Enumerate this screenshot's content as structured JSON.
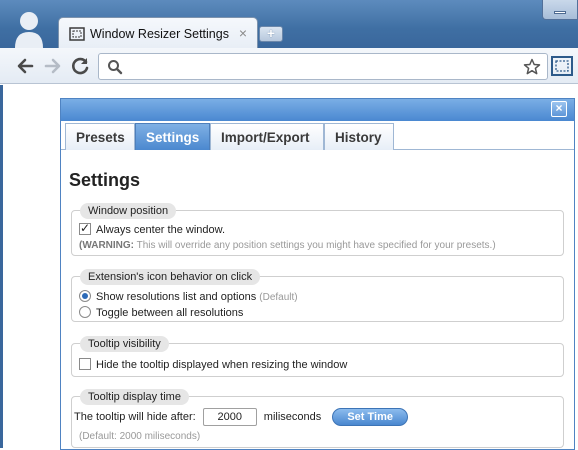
{
  "browser": {
    "tab_title": "Window Resizer Settings",
    "tab_close": "×",
    "new_tab": "+",
    "icons": [
      "profile-icon",
      "window-icon",
      "back-arrow-icon",
      "forward-arrow-icon",
      "reload-icon",
      "search-icon",
      "star-icon",
      "window-resizer-icon"
    ],
    "omnibox_value": ""
  },
  "popup": {
    "close": "×",
    "tabs": [
      {
        "label": "Presets",
        "active": false
      },
      {
        "label": "Settings",
        "active": true
      },
      {
        "label": "Import/Export",
        "active": false
      },
      {
        "label": "History",
        "active": false
      }
    ],
    "title": "Settings",
    "window_position": {
      "legend": "Window position",
      "center_label": "Always center the window.",
      "center_checked": true,
      "warning_prefix": "(WARNING:",
      "warning_text": " This will override any position settings you might have specified for your presets.)"
    },
    "icon_behavior": {
      "legend": "Extension's icon behavior on click",
      "option1_label": "Show resolutions list and options",
      "option1_note": "(Default)",
      "option2_label": "Toggle between all resolutions",
      "selected": 1
    },
    "tooltip_visibility": {
      "legend": "Tooltip visibility",
      "hide_label": "Hide the tooltip displayed when resizing the window",
      "hide_checked": false
    },
    "tooltip_time": {
      "legend": "Tooltip display time",
      "prefix": "The tooltip will hide after:",
      "value": "2000",
      "suffix": "miliseconds",
      "button": "Set Time",
      "default_note": "(Default: 2000 miliseconds)"
    }
  },
  "colors": {
    "accent": "#4a88d1",
    "frame": "#3f6fa3"
  }
}
